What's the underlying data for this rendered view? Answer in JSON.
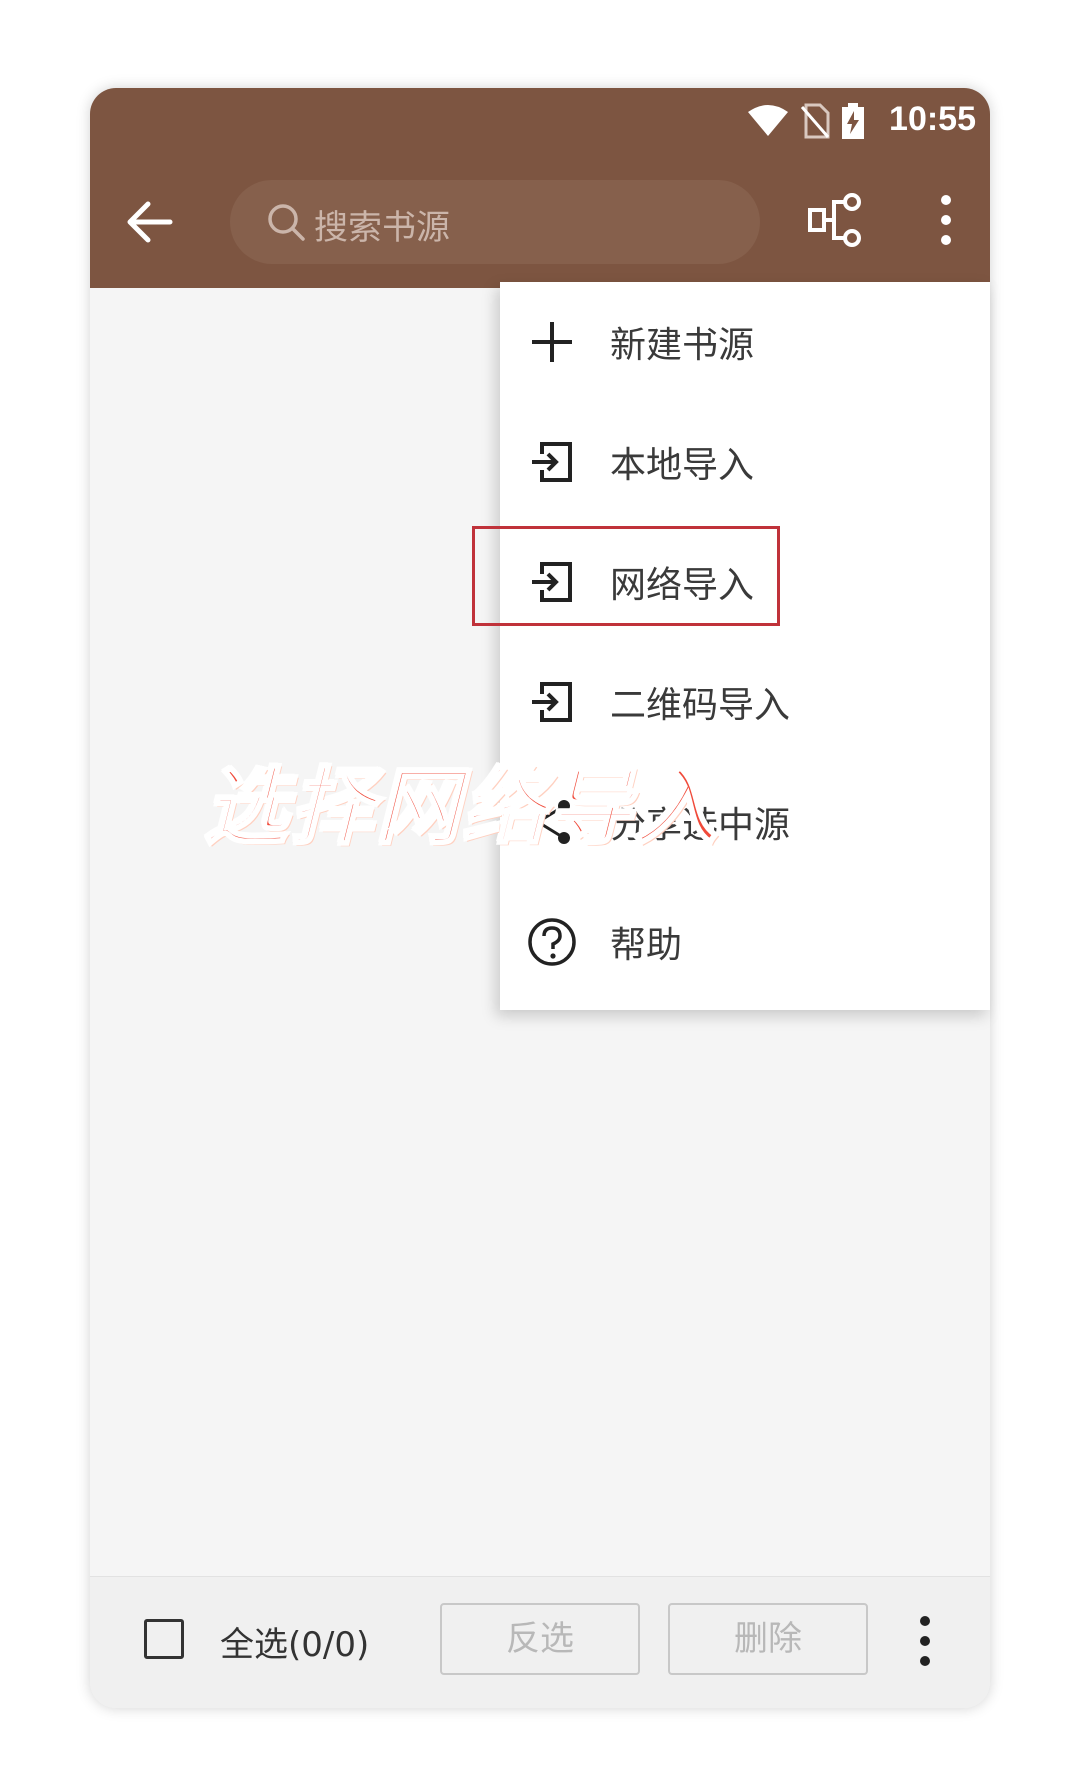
{
  "status_bar": {
    "time": "10:55"
  },
  "toolbar": {
    "search_placeholder": "搜索书源"
  },
  "menu": {
    "items": [
      {
        "label": "新建书源",
        "icon": "plus-icon"
      },
      {
        "label": "本地导入",
        "icon": "import-icon"
      },
      {
        "label": "网络导入",
        "icon": "import-icon"
      },
      {
        "label": "二维码导入",
        "icon": "import-icon"
      },
      {
        "label": "分享选中源",
        "icon": "share-icon"
      },
      {
        "label": "帮助",
        "icon": "help-icon"
      }
    ]
  },
  "annotation": {
    "text": "选择网络导入",
    "color": "#f04a3a"
  },
  "bottom_bar": {
    "select_all": "全选(0/0)",
    "invert_label": "反选",
    "delete_label": "删除"
  },
  "colors": {
    "appbar": "#7d5541",
    "highlight": "#c0323a"
  }
}
